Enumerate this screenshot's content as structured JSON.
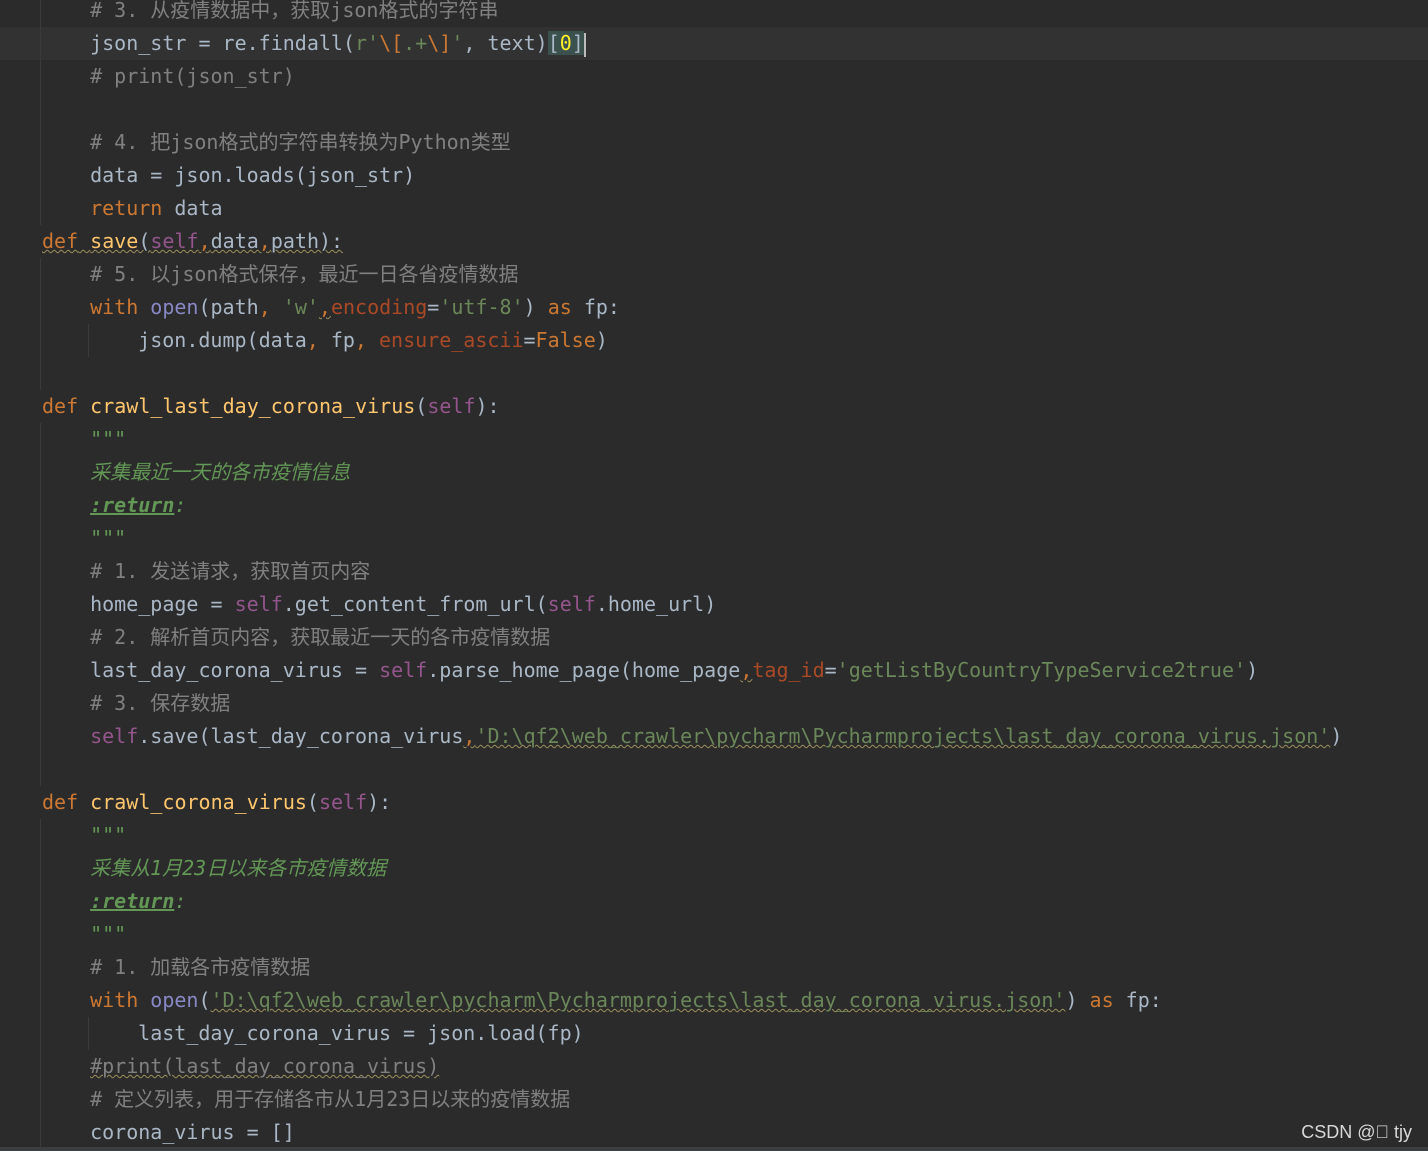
{
  "editor": {
    "lines": [
      {
        "segs": [
          [
            "cm",
            "# 3. 从疫情数据中，获取json格式的字符串"
          ]
        ]
      },
      {
        "current": true,
        "segs": [
          [
            "",
            "json_str = re.findall("
          ],
          [
            "str",
            "r'"
          ],
          [
            "esc",
            "\\["
          ],
          [
            "str",
            ".+"
          ],
          [
            "esc",
            "\\]"
          ],
          [
            "str",
            "'"
          ],
          [
            "",
            ", text)"
          ],
          [
            "hlbr",
            "["
          ],
          [
            "hl",
            "0"
          ],
          [
            "hlbr",
            "]"
          ],
          [
            "caret",
            ""
          ]
        ]
      },
      {
        "segs": [
          [
            "cm",
            "# print(json_str)"
          ]
        ]
      },
      {
        "segs": []
      },
      {
        "segs": [
          [
            "cm",
            "# 4. 把json格式的字符串转换为Python类型"
          ]
        ]
      },
      {
        "segs": [
          [
            "",
            "data = json.loads(json_str)"
          ]
        ]
      },
      {
        "segs": [
          [
            "kw",
            "return"
          ],
          [
            "",
            " data"
          ]
        ]
      },
      {
        "indent": 0,
        "segs": [
          [
            "kw wavy",
            "def"
          ],
          [
            "wavy",
            " "
          ],
          [
            "fn wavy",
            "save"
          ],
          [
            "wavy",
            "("
          ],
          [
            "self wavy",
            "self"
          ],
          [
            "kw wavy",
            ","
          ],
          [
            "wavy",
            "data"
          ],
          [
            "kw wavy",
            ","
          ],
          [
            "wavy",
            "path):"
          ]
        ]
      },
      {
        "segs": [
          [
            "cm",
            "# 5. 以json格式保存，最近一日各省疫情数据"
          ]
        ]
      },
      {
        "segs": [
          [
            "kw",
            "with"
          ],
          [
            "",
            " "
          ],
          [
            "builtin",
            "open"
          ],
          [
            "",
            "(path"
          ],
          [
            "kw",
            ","
          ],
          [
            "",
            " "
          ],
          [
            "str",
            "'w'"
          ],
          [
            "kw wavy",
            ","
          ],
          [
            "param",
            "encoding"
          ],
          [
            "",
            "="
          ],
          [
            "str",
            "'utf-8'"
          ],
          [
            "",
            ") "
          ],
          [
            "kw",
            "as"
          ],
          [
            "",
            " fp:"
          ]
        ]
      },
      {
        "indent": 2,
        "segs": [
          [
            "",
            "json.dump(data"
          ],
          [
            "kw",
            ","
          ],
          [
            "",
            " fp"
          ],
          [
            "kw",
            ","
          ],
          [
            "",
            " "
          ],
          [
            "param",
            "ensure_ascii"
          ],
          [
            "",
            "="
          ],
          [
            "kw",
            "False"
          ],
          [
            "",
            ")"
          ]
        ]
      },
      {
        "segs": []
      },
      {
        "indent": 0,
        "segs": [
          [
            "kw",
            "def"
          ],
          [
            "",
            " "
          ],
          [
            "fn",
            "crawl_last_day_corona_virus"
          ],
          [
            "",
            "("
          ],
          [
            "self",
            "self"
          ],
          [
            "",
            "):"
          ]
        ]
      },
      {
        "segs": [
          [
            "doc",
            "\"\"\""
          ]
        ]
      },
      {
        "segs": [
          [
            "doc",
            "采集最近一天的各市疫情信息"
          ]
        ]
      },
      {
        "segs": [
          [
            "doctag",
            ":return"
          ],
          [
            "doc",
            ":"
          ]
        ]
      },
      {
        "segs": [
          [
            "doc",
            "\"\"\""
          ]
        ]
      },
      {
        "segs": [
          [
            "cm",
            "# 1. 发送请求，获取首页内容"
          ]
        ]
      },
      {
        "segs": [
          [
            "",
            "home_page = "
          ],
          [
            "self",
            "self"
          ],
          [
            "",
            ".get_content_from_url("
          ],
          [
            "self",
            "self"
          ],
          [
            "",
            ".home_url)"
          ]
        ]
      },
      {
        "segs": [
          [
            "cm",
            "# 2. 解析首页内容，获取最近一天的各市疫情数据"
          ]
        ]
      },
      {
        "segs": [
          [
            "",
            "last_day_corona_virus = "
          ],
          [
            "self",
            "self"
          ],
          [
            "",
            ".parse_home_page(home_page"
          ],
          [
            "kw wavy",
            ","
          ],
          [
            "param",
            "tag_id"
          ],
          [
            "",
            "="
          ],
          [
            "str",
            "'getListByCountryTypeService2true'"
          ],
          [
            "",
            ")"
          ]
        ]
      },
      {
        "segs": [
          [
            "cm",
            "# 3. 保存数据"
          ]
        ]
      },
      {
        "segs": [
          [
            "self",
            "self"
          ],
          [
            "",
            ".save(last_day_corona_virus"
          ],
          [
            "kw wavy",
            ","
          ],
          [
            "str wavy",
            "'D:\\qf2\\web_crawler\\pycharm\\Pycharmprojects\\last_day_corona_virus.json'"
          ],
          [
            "",
            ")"
          ]
        ]
      },
      {
        "segs": []
      },
      {
        "indent": 0,
        "segs": [
          [
            "kw",
            "def"
          ],
          [
            "",
            " "
          ],
          [
            "fn",
            "crawl_corona_virus"
          ],
          [
            "",
            "("
          ],
          [
            "self",
            "self"
          ],
          [
            "",
            "):"
          ]
        ]
      },
      {
        "segs": [
          [
            "doc",
            "\"\"\""
          ]
        ]
      },
      {
        "segs": [
          [
            "doc",
            "采集从1月23日以来各市疫情数据"
          ]
        ]
      },
      {
        "segs": [
          [
            "doctag",
            ":return"
          ],
          [
            "doc",
            ":"
          ]
        ]
      },
      {
        "segs": [
          [
            "doc",
            "\"\"\""
          ]
        ]
      },
      {
        "segs": [
          [
            "cm",
            "# 1. 加载各市疫情数据"
          ]
        ]
      },
      {
        "segs": [
          [
            "kw",
            "with"
          ],
          [
            "",
            " "
          ],
          [
            "builtin",
            "open"
          ],
          [
            "",
            "("
          ],
          [
            "str wavy",
            "'D:\\qf2\\web_crawler\\pycharm\\Pycharmprojects\\last_day_corona_virus.json'"
          ],
          [
            "",
            ") "
          ],
          [
            "kw",
            "as"
          ],
          [
            "",
            " fp:"
          ]
        ]
      },
      {
        "indent": 2,
        "segs": [
          [
            "",
            "last_day_corona_virus = json.load(fp)"
          ]
        ]
      },
      {
        "segs": [
          [
            "cm wavy",
            "#print(last_day_corona_virus)"
          ]
        ]
      },
      {
        "segs": [
          [
            "cm",
            "# 定义列表，用于存储各市从1月23日以来的疫情数据"
          ]
        ]
      },
      {
        "segs": [
          [
            "",
            "corona_virus = []"
          ]
        ]
      }
    ]
  },
  "watermark": "CSDN @\u0000 tjy",
  "colors": {
    "background": "#2b2b2b",
    "current_line": "#323232",
    "keyword": "#cc7832",
    "function": "#ffc66d",
    "self": "#94558d",
    "string": "#6a8759",
    "comment": "#808080",
    "docstring": "#629755"
  }
}
